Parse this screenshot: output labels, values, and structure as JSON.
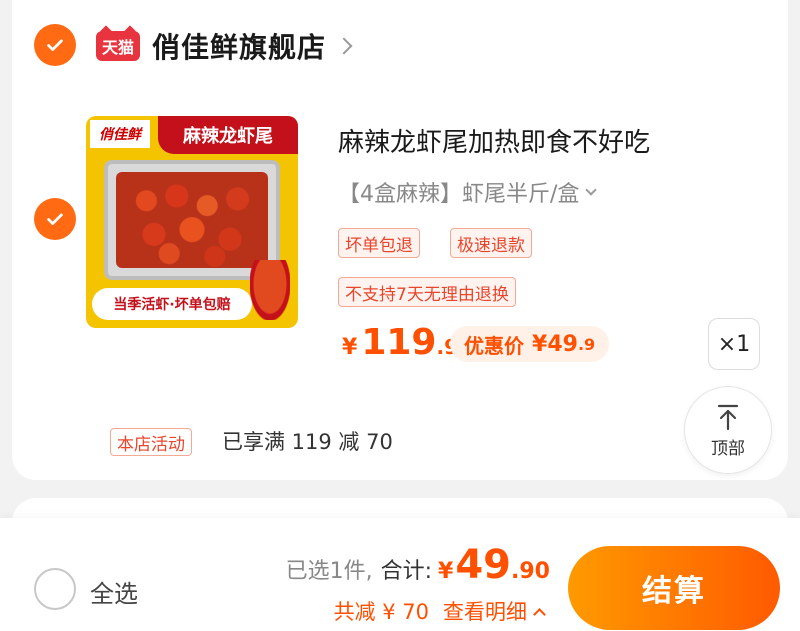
{
  "shop": {
    "badge": "天猫",
    "name": "俏佳鲜旗舰店"
  },
  "product": {
    "image": {
      "brand": "俏佳鲜",
      "title": "麻辣龙虾尾",
      "banner": "当季活虾·坏单包赔"
    },
    "title": "麻辣龙虾尾加热即食不好吃",
    "sku": "【4盒麻辣】虾尾半斤/盒",
    "tags": [
      "坏单包退",
      "极速退款",
      "不支持7天无理由退换"
    ],
    "price": {
      "currency": "¥",
      "integer": "119",
      "decimal": ".9"
    },
    "discount": {
      "label": "优惠价",
      "currency": "¥",
      "integer": "49",
      "decimal": ".9"
    },
    "quantity": "×1"
  },
  "promo": {
    "tag": "本店活动",
    "text": "已享满 119 减 70"
  },
  "back_to_top": {
    "label": "顶部"
  },
  "footer": {
    "select_all": "全选",
    "selected_count": "已选1件,",
    "total_label": "合计:",
    "total_currency": "¥",
    "total_integer": "49",
    "total_decimal": ".90",
    "savings": "共减 ¥ 70",
    "detail_link": "查看明细",
    "checkout": "结算"
  },
  "colors": {
    "accent": "#ff5000",
    "check": "#ff6a13",
    "tmall_red": "#e8343f"
  }
}
